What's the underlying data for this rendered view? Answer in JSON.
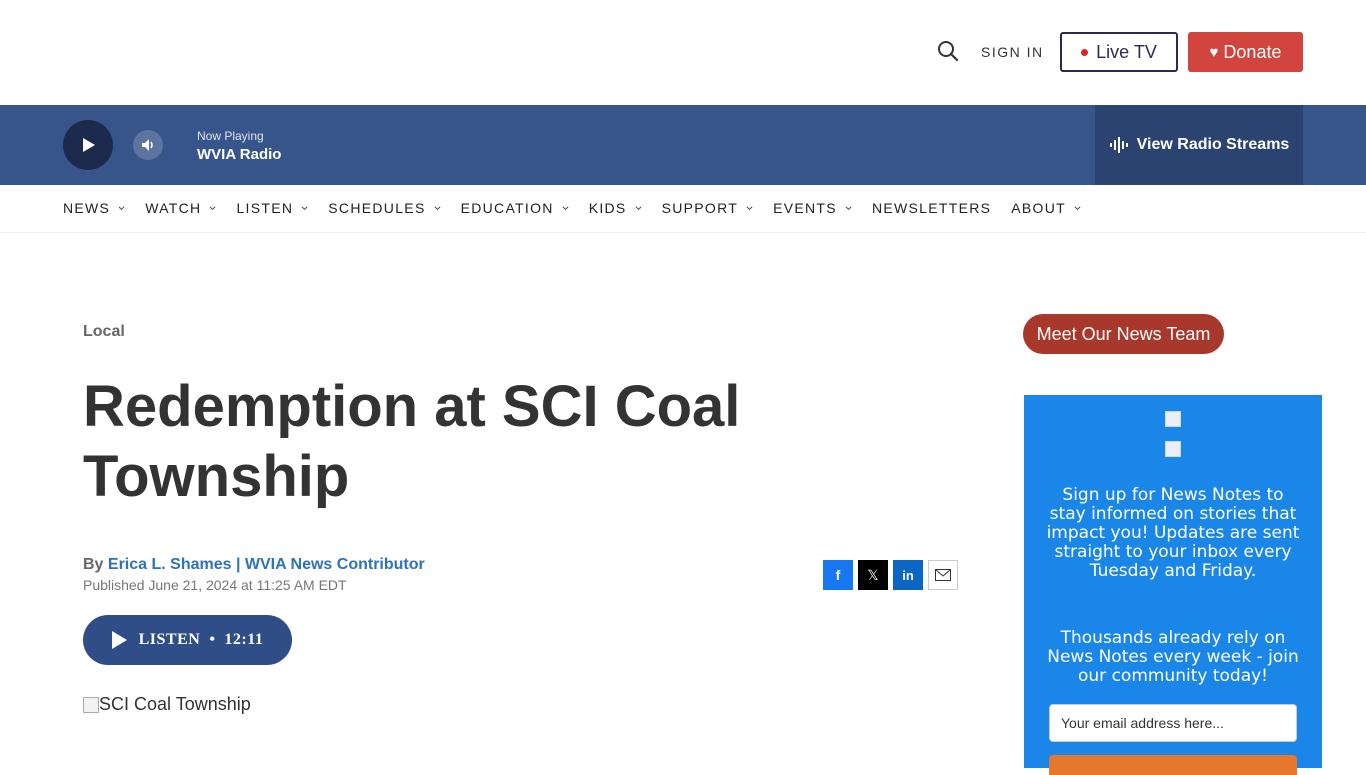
{
  "header": {
    "signin": "SIGN IN",
    "livetv": "Live TV",
    "donate": "Donate"
  },
  "player": {
    "now_playing_label": "Now Playing",
    "station": "WVIA Radio",
    "streams": "View Radio Streams"
  },
  "nav": {
    "items": [
      {
        "label": "NEWS",
        "dropdown": true
      },
      {
        "label": "WATCH",
        "dropdown": true
      },
      {
        "label": "LISTEN",
        "dropdown": true
      },
      {
        "label": "SCHEDULES",
        "dropdown": true
      },
      {
        "label": "EDUCATION",
        "dropdown": true
      },
      {
        "label": "KIDS",
        "dropdown": true
      },
      {
        "label": "SUPPORT",
        "dropdown": true
      },
      {
        "label": "EVENTS",
        "dropdown": true
      },
      {
        "label": "NEWSLETTERS",
        "dropdown": false
      },
      {
        "label": "ABOUT",
        "dropdown": true
      }
    ]
  },
  "article": {
    "section": "Local",
    "headline": "Redemption at SCI Coal Township",
    "byline_prefix": "By",
    "author": "Erica L. Shames | WVIA News Contributor",
    "published": "Published June 21, 2024 at 11:25 AM EDT",
    "listen_label": "LISTEN",
    "listen_sep": "•",
    "duration": "12:11",
    "image_alt": "SCI Coal Township"
  },
  "share": {
    "facebook": "f",
    "x": "𝕏",
    "linkedin": "in"
  },
  "sidebar": {
    "news_team": "Meet Our News Team",
    "promo_text1": "Sign up for News Notes to stay informed on stories that impact you! Updates are sent straight to your inbox every Tuesday and Friday.",
    "promo_text2": "Thousands already rely on News Notes every week - join our community today!",
    "email_placeholder": "Your email address here..."
  },
  "colors": {
    "player_bg": "#37548b",
    "donate": "#d1453e",
    "news_team": "#a8382b",
    "promo_bg": "#1a87e8"
  }
}
